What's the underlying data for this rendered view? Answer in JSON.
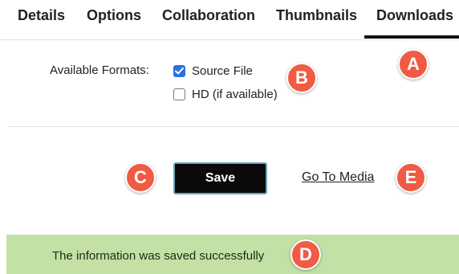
{
  "tabs": [
    {
      "label": "Details"
    },
    {
      "label": "Options"
    },
    {
      "label": "Collaboration"
    },
    {
      "label": "Thumbnails"
    },
    {
      "label": "Downloads",
      "active": true
    }
  ],
  "formats": {
    "label": "Available Formats:",
    "options": [
      {
        "label": "Source File",
        "checked": true
      },
      {
        "label": "HD (if available)",
        "checked": false
      }
    ]
  },
  "actions": {
    "save_label": "Save",
    "go_to_media_label": "Go To Media"
  },
  "banner": {
    "message": "The information was saved successfully"
  },
  "markers": {
    "a": "A",
    "b": "B",
    "c": "C",
    "d": "D",
    "e": "E"
  },
  "colors": {
    "accent_checkbox": "#2f6fde",
    "marker": "#ef5b43",
    "banner_bg": "#c3e0a5",
    "save_bg": "#0a0a0a",
    "save_border": "#6aa9bd"
  }
}
